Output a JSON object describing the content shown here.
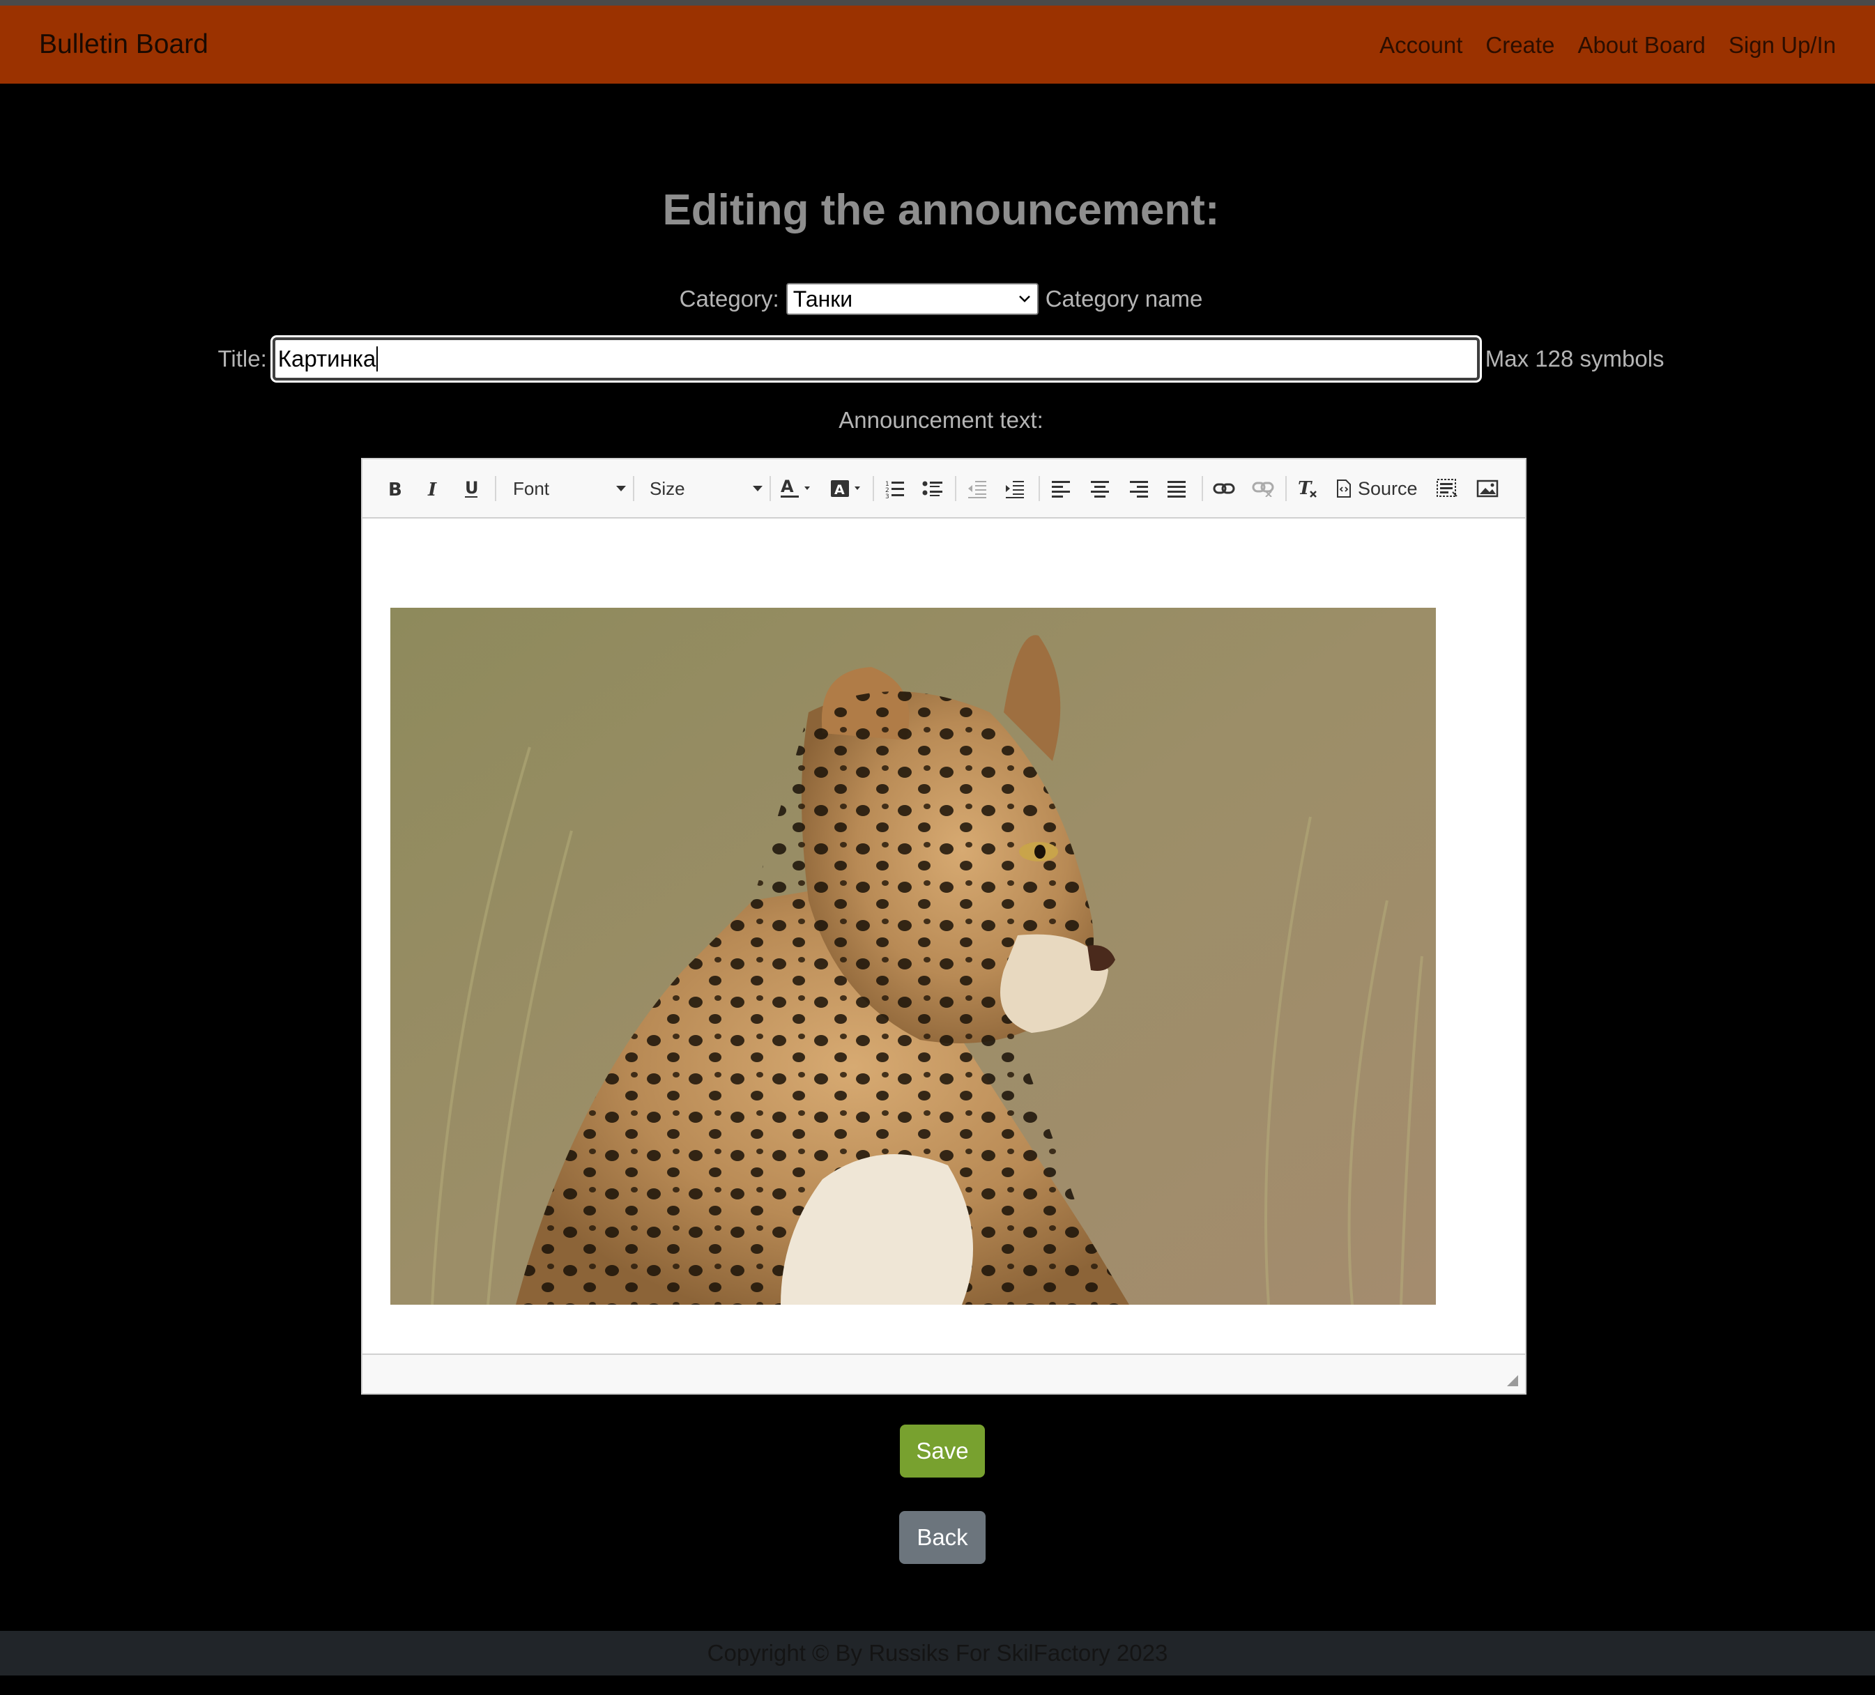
{
  "navbar": {
    "brand": "Bulletin Board",
    "links": [
      "Account",
      "Create",
      "About Board",
      "Sign Up/In"
    ],
    "color": "#9b3200"
  },
  "main": {
    "title": "Editing the announcement:",
    "category_label": "Category:",
    "category_value": "Танки",
    "category_hint": "Category name",
    "title_label": "Title:",
    "title_value": "Картинка",
    "title_hint": "Max 128 symbols",
    "text_label": "Announcement text:"
  },
  "editor": {
    "font_combo": "Font",
    "size_combo": "Size",
    "source_label": "Source",
    "toolbar_icons": [
      "bold-icon",
      "italic-icon",
      "underline-icon",
      "text-color-icon",
      "background-color-icon",
      "numbered-list-icon",
      "bulleted-list-icon",
      "decrease-indent-icon",
      "increase-indent-icon",
      "align-left-icon",
      "align-center-icon",
      "align-right-icon",
      "justify-icon",
      "link-icon",
      "unlink-icon",
      "remove-format-icon",
      "source-icon",
      "show-blocks-icon",
      "image-icon"
    ],
    "content_image": "leopard-photo"
  },
  "buttons": {
    "save": "Save",
    "back": "Back",
    "save_color": "#78a12f",
    "back_color": "#6c757d"
  },
  "footer": {
    "text": "Copyright © By Russiks For SkilFactory 2023"
  }
}
